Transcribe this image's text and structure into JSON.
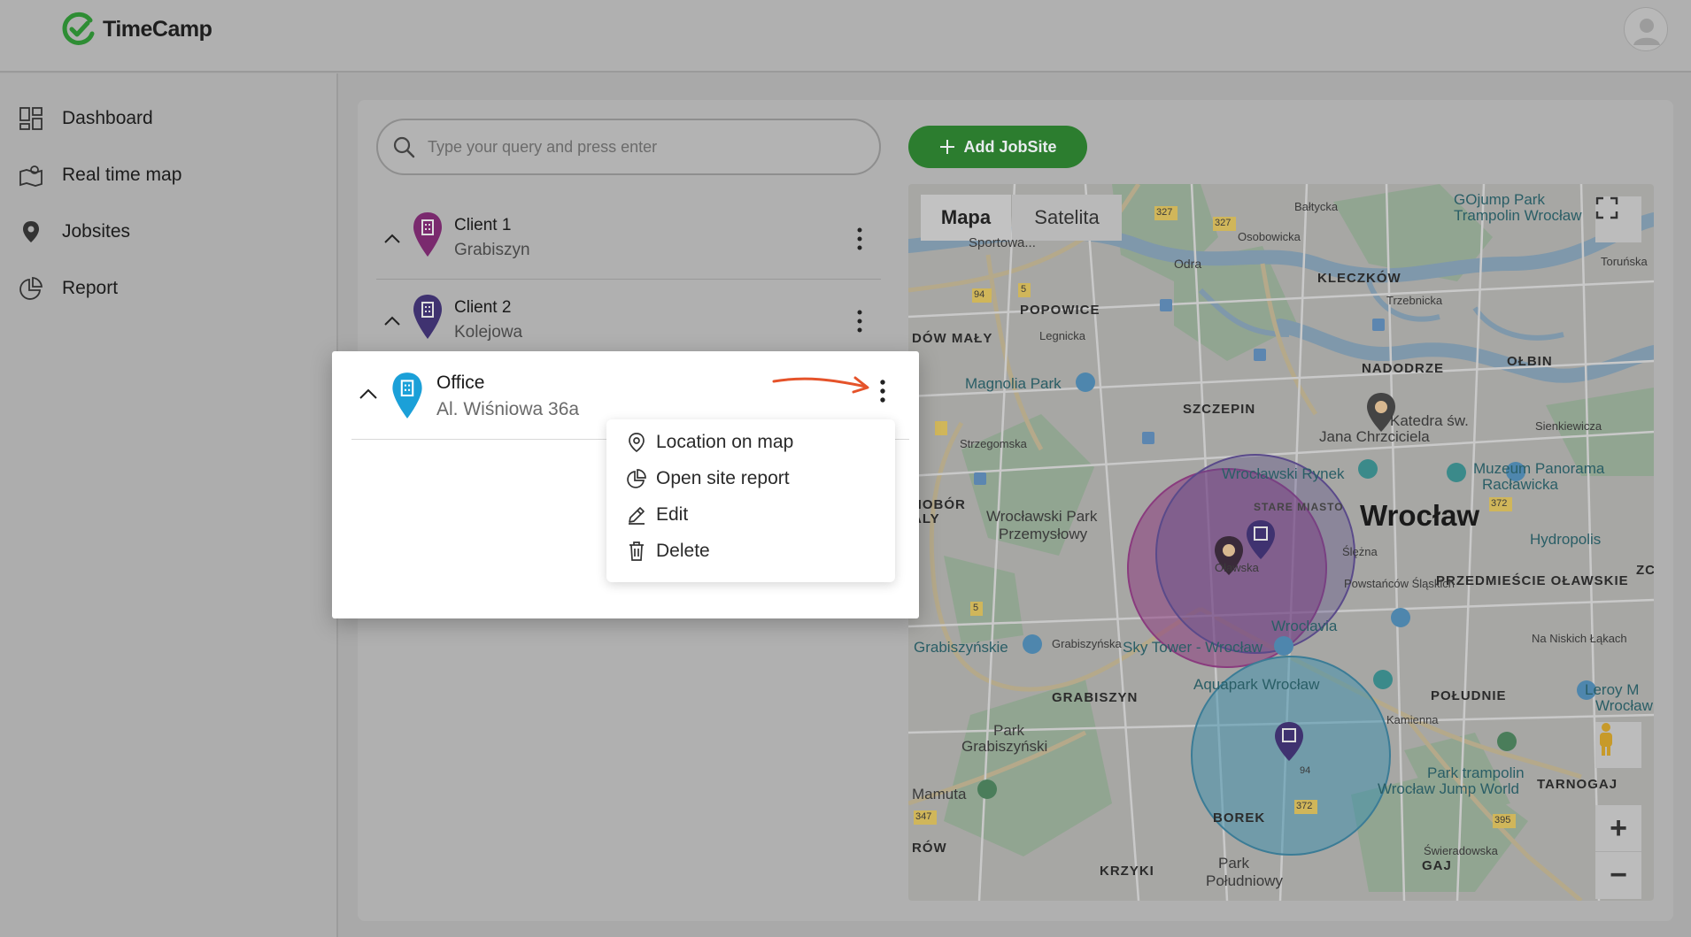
{
  "app": {
    "name": "TimeCamp",
    "brand_color": "#2e9e3c"
  },
  "sidebar": {
    "items": [
      {
        "label": "Dashboard",
        "icon": "dashboard-icon"
      },
      {
        "label": "Real time map",
        "icon": "map-icon"
      },
      {
        "label": "Jobsites",
        "icon": "location-pin-icon"
      },
      {
        "label": "Report",
        "icon": "pie-chart-icon"
      }
    ]
  },
  "search": {
    "placeholder": "Type your query and press enter"
  },
  "toolbar": {
    "add_jobsite_label": "Add JobSite"
  },
  "jobsites": [
    {
      "name": "Client 1",
      "address": "Grabiszyn",
      "pin_color": "#7a2a6e"
    },
    {
      "name": "Client 2",
      "address": "Kolejowa",
      "pin_color": "#3f3270"
    },
    {
      "name": "Office",
      "address": "Al. Wiśniowa 36a",
      "pin_color": "#1ba0d8"
    }
  ],
  "context_menu": {
    "items": [
      {
        "label": "Location on map",
        "icon": "location-pin-icon"
      },
      {
        "label": "Open site report",
        "icon": "pie-chart-icon"
      },
      {
        "label": "Edit",
        "icon": "pencil-icon"
      },
      {
        "label": "Delete",
        "icon": "trash-icon"
      }
    ]
  },
  "map": {
    "tabs": [
      "Mapa",
      "Satelita"
    ],
    "active_tab": "Mapa",
    "labels": {
      "city": "Wrocław",
      "districts": [
        "KLECZKÓW",
        "POPOWICE",
        "NADODRZE",
        "OŁBIN",
        "SZCZEPIN",
        "STARE MIASTO",
        "PRZEDMIEŚCIE OŁAWSKIE",
        "GRABISZYN",
        "POŁUDNIE",
        "BOREK",
        "KRZYKI",
        "GAJ",
        "TARNOGAJ",
        "DÓW MAŁY",
        "HOBÓR",
        "ALY",
        "RÓW",
        "ZC"
      ],
      "places": [
        "GOjump Park",
        "Trampolin Wrocław",
        "Magnolia Park",
        "Wrocławski Park",
        "Przemysłowy",
        "Wrocławski Rynek",
        "Muzeum Panorama",
        "Racławicka",
        "Hydropolis",
        "Jana Chrzciciela",
        "Katedra św.",
        "Sky Tower - Wrocław",
        "Wroclavia",
        "Aquapark Wrocław",
        "Grabiszyńskie",
        "Park",
        "Grabiszyński",
        "Mamuta",
        "Park trampolin",
        "Wrocław Jump World",
        "Park",
        "Południowy",
        "Leroy M",
        "Wrocław",
        "Sportowa..."
      ],
      "streets": [
        "Odra",
        "Osobowicka",
        "Legnicka",
        "Strzegomska",
        "Sienkiewicza",
        "Grabiszyńska",
        "Kamienna",
        "Na Niskich Łąkach",
        "Toruńska",
        "Ślężna",
        "Powstańców Śląskich",
        "Bałtycka",
        "Trzebnicka",
        "Świeradowska",
        "Oławska"
      ],
      "road_numbers": [
        "327",
        "327",
        "94",
        "5",
        "372",
        "5",
        "395",
        "372",
        "347",
        "94"
      ]
    },
    "controls": {
      "zoom_in": "+",
      "zoom_out": "−"
    }
  }
}
